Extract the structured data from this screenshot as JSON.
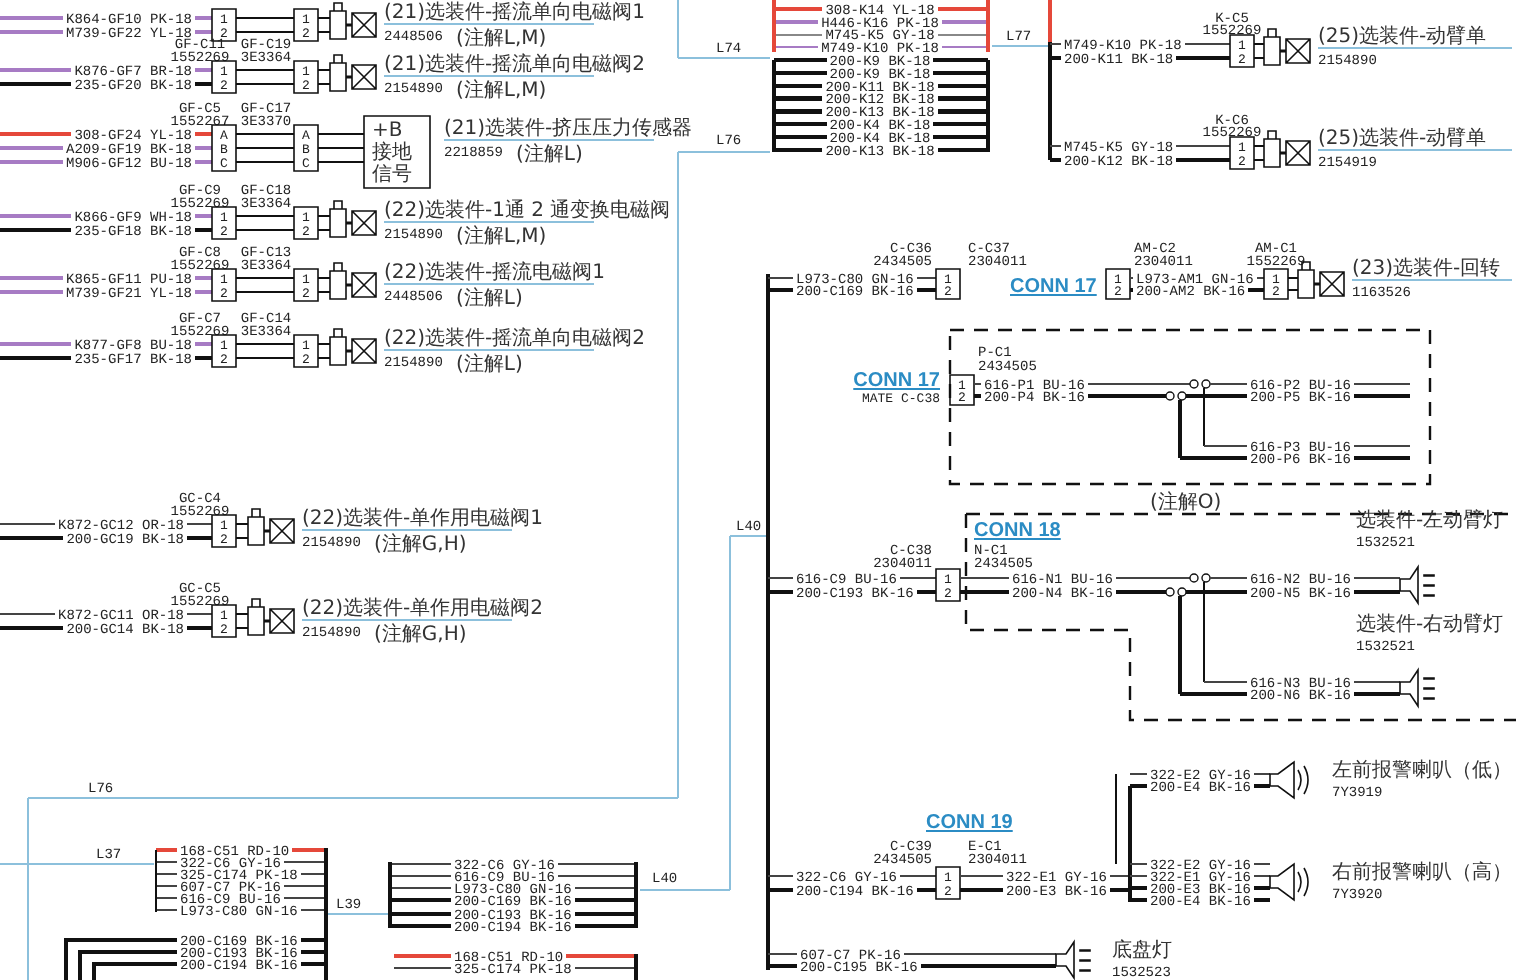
{
  "valves": [
    {
      "kind": "solenoid",
      "connector": {
        "pins": [
          "1",
          "2"
        ]
      },
      "mate": {
        "pins": [
          "1",
          "2"
        ]
      },
      "wires": [
        {
          "label": "K864-GF10 PK-18",
          "color": "#a77bc4",
          "heavy": true
        },
        {
          "label": "M739-GF22 YL-18",
          "color": "#a77bc4",
          "heavy": true
        }
      ],
      "title": "(21)选装件-摇流单向电磁阀1",
      "part_no": "2448506",
      "note": "(注解L,M)"
    },
    {
      "kind": "solenoid",
      "connector": {
        "id": "GF-C11",
        "part_no": "1552269",
        "pins": [
          "1",
          "2"
        ]
      },
      "mate": {
        "id": "GF-C19",
        "part_no": "3E3364",
        "pins": [
          "1",
          "2"
        ]
      },
      "wires": [
        {
          "label": "K876-GF7 BR-18",
          "color": "#a77bc4",
          "heavy": true
        },
        {
          "label": "235-GF20 BK-18",
          "color": "#111111",
          "heavy": true
        }
      ],
      "title": "(21)选装件-摇流单向电磁阀2",
      "part_no": "2154890",
      "note": "(注解L,M)"
    },
    {
      "kind": "sensor",
      "connector": {
        "id": "GF-C5",
        "part_no": "1552267",
        "pins": [
          "A",
          "B",
          "C"
        ]
      },
      "mate": {
        "id": "GF-C17",
        "part_no": "3E3370",
        "pins": [
          "A",
          "B",
          "C"
        ]
      },
      "wires": [
        {
          "label": "308-GF24 YL-18",
          "color": "#e5483a",
          "heavy": true
        },
        {
          "label": "A209-GF19 BK-18",
          "color": "#a77bc4",
          "heavy": true
        },
        {
          "label": "M906-GF12 BU-18",
          "color": "#a77bc4",
          "heavy": true
        }
      ],
      "terminals": [
        "+B",
        "接地",
        "信号"
      ],
      "title": "(21)选装件-挤压压力传感器",
      "part_no": "2218859",
      "note": "(注解L)"
    },
    {
      "kind": "solenoid",
      "connector": {
        "id": "GF-C9",
        "part_no": "1552269",
        "pins": [
          "1",
          "2"
        ]
      },
      "mate": {
        "id": "GF-C18",
        "part_no": "3E3364",
        "pins": [
          "1",
          "2"
        ]
      },
      "wires": [
        {
          "label": "K866-GF9 WH-18",
          "color": "#a77bc4",
          "heavy": true
        },
        {
          "label": "235-GF18 BK-18",
          "color": "#111111",
          "heavy": true
        }
      ],
      "title": "(22)选装件-1通 2 通变换电磁阀",
      "part_no": "2154890",
      "note": "(注解L,M)"
    },
    {
      "kind": "solenoid",
      "connector": {
        "id": "GF-C8",
        "part_no": "1552269",
        "pins": [
          "1",
          "2"
        ]
      },
      "mate": {
        "id": "GF-C13",
        "part_no": "3E3364",
        "pins": [
          "1",
          "2"
        ]
      },
      "wires": [
        {
          "label": "K865-GF11 PU-18",
          "color": "#a77bc4",
          "heavy": true
        },
        {
          "label": "M739-GF21 YL-18",
          "color": "#a77bc4",
          "heavy": true
        }
      ],
      "title": "(22)选装件-摇流电磁阀1",
      "part_no": "2448506",
      "note": "(注解L)"
    },
    {
      "kind": "solenoid",
      "connector": {
        "id": "GF-C7",
        "part_no": "1552269",
        "pins": [
          "1",
          "2"
        ]
      },
      "mate": {
        "id": "GF-C14",
        "part_no": "3E3364",
        "pins": [
          "1",
          "2"
        ]
      },
      "wires": [
        {
          "label": "K877-GF8 BU-18",
          "color": "#a77bc4",
          "heavy": true
        },
        {
          "label": "235-GF17 BK-18",
          "color": "#111111",
          "heavy": true
        }
      ],
      "title": "(22)选装件-摇流单向电磁阀2",
      "part_no": "2154890",
      "note": "(注解L)"
    },
    {
      "kind": "solenoid",
      "connector": {
        "id": "GC-C4",
        "part_no": "1552269",
        "pins": [
          "1",
          "2"
        ]
      },
      "wires": [
        {
          "label": "K872-GC12 OR-18",
          "color": "#444444",
          "heavy": false
        },
        {
          "label": "200-GC19 BK-18",
          "color": "#111111",
          "heavy": true
        }
      ],
      "title": "(22)选装件-单作用电磁阀1",
      "part_no": "2154890",
      "note": "(注解G,H)"
    },
    {
      "kind": "solenoid",
      "connector": {
        "id": "GC-C5",
        "part_no": "1552269",
        "pins": [
          "1",
          "2"
        ]
      },
      "wires": [
        {
          "label": "K872-GC11 OR-18",
          "color": "#444444",
          "heavy": false
        },
        {
          "label": "200-GC14 BK-18",
          "color": "#111111",
          "heavy": true
        }
      ],
      "title": "(22)选装件-单作用电磁阀2",
      "part_no": "2154890",
      "note": "(注解G,H)"
    }
  ],
  "harness_top": {
    "wires": [
      {
        "label": "308-K14 YL-18",
        "color": "#e5483a",
        "heavy": true
      },
      {
        "label": "H446-K16 PK-18",
        "color": "#a77bc4",
        "heavy": true
      },
      {
        "label": "M745-K5 GY-18",
        "color": "#888888",
        "heavy": false
      },
      {
        "label": "M749-K10 PK-18",
        "color": "#a77bc4",
        "heavy": false
      },
      {
        "label": "200-K9 BK-18",
        "color": "#111111",
        "heavy": true
      },
      {
        "label": "200-K9 BK-18",
        "color": "#111111",
        "heavy": true
      },
      {
        "label": "200-K11 BK-18",
        "color": "#111111",
        "heavy": true
      },
      {
        "label": "200-K12 BK-18",
        "color": "#111111",
        "heavy": true
      },
      {
        "label": "200-K13 BK-18",
        "color": "#111111",
        "heavy": true
      },
      {
        "label": "200-K4 BK-18",
        "color": "#111111",
        "heavy": true
      },
      {
        "label": "200-K4 BK-18",
        "color": "#111111",
        "heavy": true
      },
      {
        "label": "200-K13 BK-18",
        "color": "#111111",
        "heavy": true
      }
    ]
  },
  "harness_labels": [
    "L74",
    "L76",
    "L77",
    "L40",
    "L40",
    "L76",
    "L37",
    "L39"
  ],
  "boom_valves": [
    {
      "connector": {
        "id": "K-C5",
        "part_no": "1552269",
        "pins": [
          "1",
          "2"
        ]
      },
      "wires": [
        {
          "label": "M749-K10 PK-18",
          "color": "#444444",
          "heavy": false
        },
        {
          "label": "200-K11 BK-18",
          "color": "#111111",
          "heavy": true
        }
      ],
      "title": "(25)选装件-动臂单",
      "part_no": "2154890"
    },
    {
      "connector": {
        "id": "K-C6",
        "part_no": "1552269",
        "pins": [
          "1",
          "2"
        ]
      },
      "wires": [
        {
          "label": "M745-K5 GY-18",
          "color": "#444444",
          "heavy": false
        },
        {
          "label": "200-K12 BK-18",
          "color": "#111111",
          "heavy": true
        }
      ],
      "title": "(25)选装件-动臂单",
      "part_no": "2154919"
    }
  ],
  "swing_valve": {
    "connector": {
      "id": "C-C36",
      "part_no": "2434505",
      "pins": [
        "1",
        "2"
      ]
    },
    "input_wires": [
      {
        "label": "L973-C80 GN-16",
        "color": "#444444",
        "heavy": false
      },
      {
        "label": "200-C169 BK-16",
        "color": "#111111",
        "heavy": true
      }
    ],
    "mate": {
      "id": "C-C37",
      "part_no": "2304011"
    },
    "link": "CONN 17",
    "remote": {
      "id": "AM-C2",
      "part_no": "2304011",
      "pins": [
        "1",
        "2"
      ]
    },
    "wires": [
      {
        "label": "L973-AM1 GN-16",
        "color": "#444444",
        "heavy": false
      },
      {
        "label": "200-AM2 BK-16",
        "color": "#111111",
        "heavy": true
      }
    ],
    "end": {
      "id": "AM-C1",
      "part_no": "1552269",
      "pins": [
        "1",
        "2"
      ]
    },
    "title": "(23)选装件-回转",
    "part_no": "1163526"
  },
  "cab_lights": {
    "connector": {
      "id": "P-C1",
      "part_no": "2434505",
      "pins": [
        "1",
        "2"
      ]
    },
    "link": "CONN 17",
    "mate_label": "MATE C-C38",
    "wires": [
      {
        "label": "616-P1 BU-16",
        "color": "#444444",
        "heavy": false
      },
      {
        "label": "200-P4 BK-16",
        "color": "#111111",
        "heavy": true
      }
    ],
    "branches": [
      [
        {
          "label": "616-P2 BU-16",
          "color": "#444444",
          "heavy": false
        },
        {
          "label": "200-P5 BK-16",
          "color": "#111111",
          "heavy": true
        }
      ],
      [
        {
          "label": "616-P3 BU-16",
          "color": "#444444",
          "heavy": false
        },
        {
          "label": "200-P6 BK-16",
          "color": "#111111",
          "heavy": true
        }
      ]
    ],
    "note": "(注解O)"
  },
  "boom_lights": {
    "connector": {
      "id": "C-C38",
      "part_no": "2304011",
      "pins": [
        "1",
        "2"
      ]
    },
    "input_wires": [
      {
        "label": "616-C9 BU-16",
        "color": "#444444",
        "heavy": false
      },
      {
        "label": "200-C193 BK-16",
        "color": "#111111",
        "heavy": true
      }
    ],
    "mate": {
      "id": "N-C1",
      "part_no": "2434505"
    },
    "link": "CONN 18",
    "wires": [
      {
        "label": "616-N1 BU-16",
        "color": "#444444",
        "heavy": false
      },
      {
        "label": "200-N4 BK-16",
        "color": "#111111",
        "heavy": true
      }
    ],
    "branches": [
      [
        {
          "label": "616-N2 BU-16",
          "color": "#444444",
          "heavy": false
        },
        {
          "label": "200-N5 BK-16",
          "color": "#111111",
          "heavy": true
        }
      ],
      [
        {
          "label": "616-N3 BU-16",
          "color": "#444444",
          "heavy": false
        },
        {
          "label": "200-N6 BK-16",
          "color": "#111111",
          "heavy": true
        }
      ]
    ],
    "lamps": [
      {
        "title": "选装件-左动臂灯",
        "part_no": "1532521"
      },
      {
        "title": "选装件-右动臂灯",
        "part_no": "1532521"
      }
    ]
  },
  "horns": {
    "connector": {
      "id": "C-C39",
      "part_no": "2434505",
      "pins": [
        "1",
        "2"
      ]
    },
    "input_wires": [
      {
        "label": "322-C6 GY-16",
        "color": "#444444",
        "heavy": false
      },
      {
        "label": "200-C194 BK-16",
        "color": "#111111",
        "heavy": true
      }
    ],
    "mate": {
      "id": "E-C1",
      "part_no": "2304011"
    },
    "link": "CONN 19",
    "wires": [
      {
        "label": "322-E1 GY-16",
        "color": "#444444",
        "heavy": false
      },
      {
        "label": "200-E3 BK-16",
        "color": "#111111",
        "heavy": true
      }
    ],
    "horns": [
      {
        "title": "左前报警喇叭（低）",
        "part_no": "7Y3919",
        "wires": [
          {
            "label": "322-E2 GY-16",
            "color": "#444444",
            "heavy": false
          },
          {
            "label": "200-E4 BK-16",
            "color": "#111111",
            "heavy": true
          }
        ]
      },
      {
        "title": "右前报警喇叭（高）",
        "part_no": "7Y3920",
        "wires": [
          {
            "label": "322-E2 GY-16",
            "color": "#444444",
            "heavy": false
          },
          {
            "label": "322-E1 GY-16",
            "color": "#444444",
            "heavy": false
          },
          {
            "label": "200-E3 BK-16",
            "color": "#111111",
            "heavy": true
          },
          {
            "label": "200-E4 BK-16",
            "color": "#111111",
            "heavy": true
          }
        ]
      }
    ]
  },
  "chassis_light": {
    "wires": [
      {
        "label": "607-C7 PK-16",
        "color": "#444444",
        "heavy": false
      },
      {
        "label": "200-C195 BK-16",
        "color": "#111111",
        "heavy": true
      }
    ],
    "title": "底盘灯",
    "part_no": "1532523"
  },
  "bundles": [
    {
      "wires": [
        {
          "label": "168-C51 RD-10",
          "color": "#e5483a",
          "heavy": true
        },
        {
          "label": "322-C6 GY-16",
          "color": "#444444",
          "heavy": false
        },
        {
          "label": "325-C174 PK-18",
          "color": "#444444",
          "heavy": false
        },
        {
          "label": "607-C7 PK-16",
          "color": "#444444",
          "heavy": false
        },
        {
          "label": "616-C9 BU-16",
          "color": "#444444",
          "heavy": false
        },
        {
          "label": "L973-C80 GN-16",
          "color": "#444444",
          "heavy": false
        },
        {
          "label": "200-C169 BK-16",
          "color": "#111111",
          "heavy": true
        },
        {
          "label": "200-C193 BK-16",
          "color": "#111111",
          "heavy": true
        },
        {
          "label": "200-C194 BK-16",
          "color": "#111111",
          "heavy": true
        }
      ]
    },
    {
      "wires": [
        {
          "label": "322-C6 GY-16",
          "color": "#444444",
          "heavy": false
        },
        {
          "label": "616-C9 BU-16",
          "color": "#444444",
          "heavy": false
        },
        {
          "label": "L973-C80 GN-16",
          "color": "#444444",
          "heavy": false
        },
        {
          "label": "200-C169 BK-16",
          "color": "#111111",
          "heavy": true
        },
        {
          "label": "200-C193 BK-16",
          "color": "#111111",
          "heavy": true
        },
        {
          "label": "200-C194 BK-16",
          "color": "#111111",
          "heavy": true
        }
      ]
    },
    {
      "wires": [
        {
          "label": "168-C51 RD-10",
          "color": "#e5483a",
          "heavy": true
        },
        {
          "label": "325-C174 PK-18",
          "color": "#444444",
          "heavy": false
        }
      ]
    }
  ]
}
